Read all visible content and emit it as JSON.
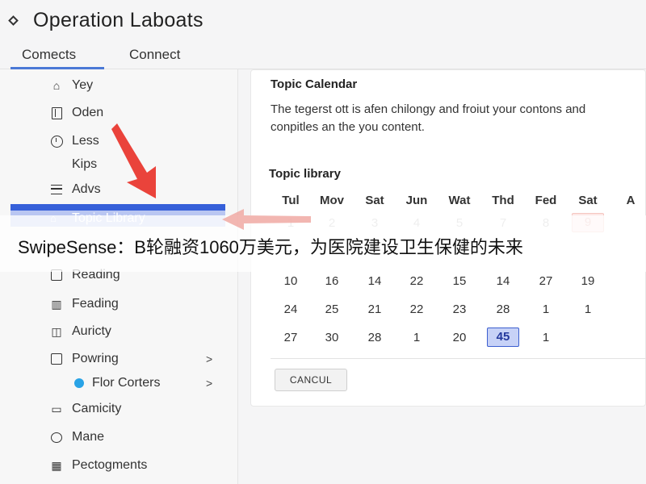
{
  "header": {
    "title": "Operation Laboats"
  },
  "tabs": [
    {
      "label": "Comects",
      "active": true
    },
    {
      "label": "Connect",
      "active": false
    }
  ],
  "sidebar": {
    "items": [
      {
        "label": "Yey",
        "icon": "home-icon"
      },
      {
        "label": "Oden",
        "icon": "document-icon"
      },
      {
        "label": "Less",
        "icon": "clock-icon"
      },
      {
        "label": "Kips",
        "icon": ""
      },
      {
        "label": "Advs",
        "icon": "list-icon"
      },
      {
        "label": "Topic Library",
        "icon": "library-icon",
        "active": true
      },
      {
        "label": "Reading",
        "icon": "book-icon"
      },
      {
        "label": "Feading",
        "icon": "columns-icon"
      },
      {
        "label": "Auricty",
        "icon": "panel-icon"
      },
      {
        "label": "Powring",
        "icon": "calendar-icon",
        "chevron": ">"
      },
      {
        "label": "Flor Corters",
        "icon": "dot-icon",
        "chevron": ">"
      },
      {
        "label": "Camicity",
        "icon": "window-icon"
      },
      {
        "label": "Mane",
        "icon": "speech-icon"
      },
      {
        "label": "Pectogments",
        "icon": "grid-icon"
      }
    ]
  },
  "content": {
    "calendar_title": "Topic Calendar",
    "description": "The tegerst ott is afen chilongy and froiut your contons and conpitles an the you content.",
    "library_title": "Topic library",
    "weekdays": [
      "Tul",
      "Mov",
      "Sat",
      "Jun",
      "Wat",
      "Thd",
      "Fed",
      "Sat",
      "A"
    ],
    "rows": [
      [
        "1",
        "2",
        "3",
        "4",
        "5",
        "7",
        "8",
        "9",
        ""
      ],
      [
        "",
        "",
        "",
        "",
        "",
        "",
        "",
        "",
        ""
      ],
      [
        "10",
        "16",
        "14",
        "22",
        "15",
        "14",
        "27",
        "19",
        ""
      ],
      [
        "24",
        "25",
        "21",
        "22",
        "23",
        "28",
        "1",
        "1",
        ""
      ],
      [
        "27",
        "30",
        "28",
        "1",
        "20",
        "45",
        "1",
        "",
        ""
      ]
    ],
    "marked_cell": "9",
    "selected_cell": "45",
    "cancel_label": "CANCUL"
  },
  "banner": {
    "text": "SwipeSense：B轮融资1060万美元，为医院建设卫生保健的未来"
  },
  "colors": {
    "accent": "#3660d9",
    "highlight": "#b9c6f2",
    "arrow": "#e8332a",
    "selected_bg": "#c7d2f7"
  }
}
